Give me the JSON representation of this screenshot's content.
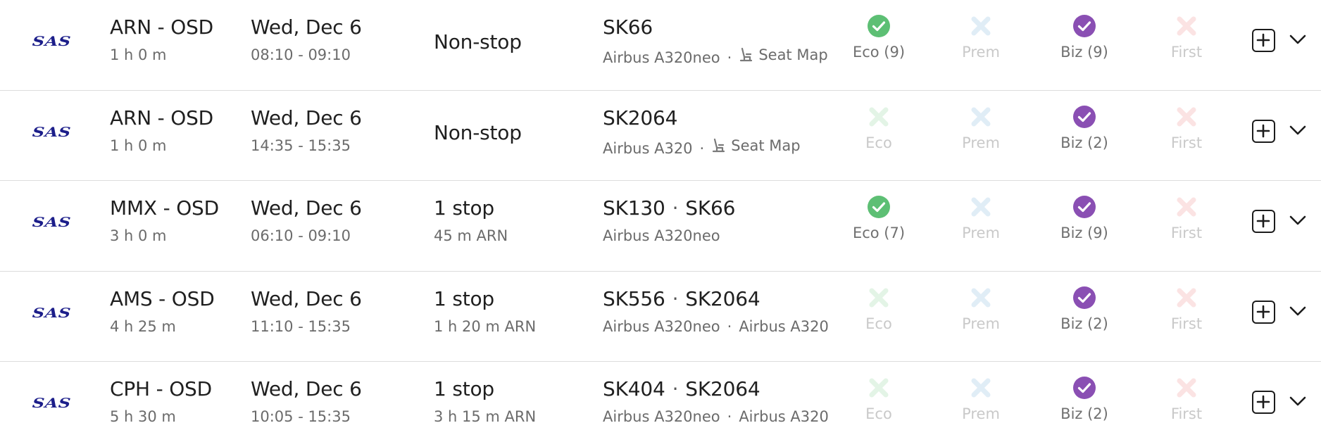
{
  "airline": {
    "logo_text": "SAS"
  },
  "cabin_labels": {
    "eco": "Eco",
    "prem": "Prem",
    "biz": "Biz",
    "first": "First"
  },
  "colors": {
    "eco_available": "#5dbf74",
    "eco_unavailable": "#e3f4e6",
    "prem_unavailable": "#e0edf6",
    "biz_available": "#8a4fb3",
    "first_unavailable": "#fbe3e3",
    "available_text": "#707070",
    "unavailable_text": "#c9c9c9"
  },
  "flights": [
    {
      "route": "ARN - OSD",
      "duration": "1 h 0 m",
      "date": "Wed, Dec 6",
      "times": "08:10 - 09:10",
      "stops": "Non-stop",
      "stop_detail": "",
      "flight_numbers": [
        "SK66"
      ],
      "aircraft": [
        "Airbus A320neo"
      ],
      "seat_map": "Seat Map",
      "eco": {
        "available": true,
        "label": "Eco (9)"
      },
      "prem": {
        "available": false,
        "label": "Prem"
      },
      "biz": {
        "available": true,
        "label": "Biz (9)"
      },
      "first": {
        "available": false,
        "label": "First"
      }
    },
    {
      "route": "ARN - OSD",
      "duration": "1 h 0 m",
      "date": "Wed, Dec 6",
      "times": "14:35 - 15:35",
      "stops": "Non-stop",
      "stop_detail": "",
      "flight_numbers": [
        "SK2064"
      ],
      "aircraft": [
        "Airbus A320"
      ],
      "seat_map": "Seat Map",
      "eco": {
        "available": false,
        "label": "Eco"
      },
      "prem": {
        "available": false,
        "label": "Prem"
      },
      "biz": {
        "available": true,
        "label": "Biz (2)"
      },
      "first": {
        "available": false,
        "label": "First"
      }
    },
    {
      "route": "MMX - OSD",
      "duration": "3 h 0 m",
      "date": "Wed, Dec 6",
      "times": "06:10 - 09:10",
      "stops": "1 stop",
      "stop_detail": "45 m ARN",
      "flight_numbers": [
        "SK130",
        "SK66"
      ],
      "aircraft": [
        "Airbus A320neo"
      ],
      "seat_map": "",
      "eco": {
        "available": true,
        "label": "Eco (7)"
      },
      "prem": {
        "available": false,
        "label": "Prem"
      },
      "biz": {
        "available": true,
        "label": "Biz (9)"
      },
      "first": {
        "available": false,
        "label": "First"
      }
    },
    {
      "route": "AMS - OSD",
      "duration": "4 h 25 m",
      "date": "Wed, Dec 6",
      "times": "11:10 - 15:35",
      "stops": "1 stop",
      "stop_detail": "1 h 20 m ARN",
      "flight_numbers": [
        "SK556",
        "SK2064"
      ],
      "aircraft": [
        "Airbus A320neo",
        "Airbus A320"
      ],
      "seat_map": "",
      "eco": {
        "available": false,
        "label": "Eco"
      },
      "prem": {
        "available": false,
        "label": "Prem"
      },
      "biz": {
        "available": true,
        "label": "Biz (2)"
      },
      "first": {
        "available": false,
        "label": "First"
      }
    },
    {
      "route": "CPH - OSD",
      "duration": "5 h 30 m",
      "date": "Wed, Dec 6",
      "times": "10:05 - 15:35",
      "stops": "1 stop",
      "stop_detail": "3 h 15 m ARN",
      "flight_numbers": [
        "SK404",
        "SK2064"
      ],
      "aircraft": [
        "Airbus A320neo",
        "Airbus A320"
      ],
      "seat_map": "",
      "eco": {
        "available": false,
        "label": "Eco"
      },
      "prem": {
        "available": false,
        "label": "Prem"
      },
      "biz": {
        "available": true,
        "label": "Biz (2)"
      },
      "first": {
        "available": false,
        "label": "First"
      }
    }
  ]
}
